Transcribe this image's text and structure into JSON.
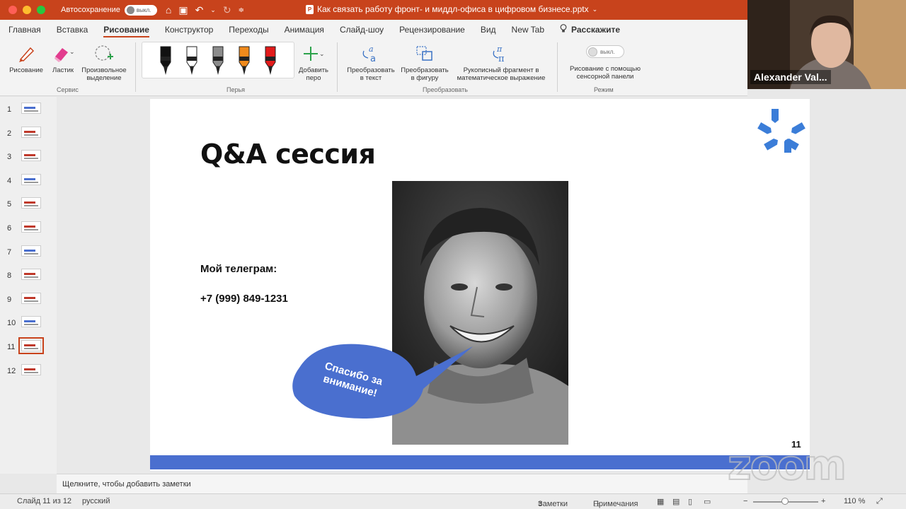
{
  "window": {
    "autosave_label": "Автосохранение",
    "autosave_state": "выкл.",
    "doc_title": "Как связать работу фронт- и миддл-офиса в цифровом бизнесе.pptx"
  },
  "tabs": [
    {
      "label": "Главная"
    },
    {
      "label": "Вставка"
    },
    {
      "label": "Рисование"
    },
    {
      "label": "Конструктор"
    },
    {
      "label": "Переходы"
    },
    {
      "label": "Анимация"
    },
    {
      "label": "Слайд-шоу"
    },
    {
      "label": "Рецензирование"
    },
    {
      "label": "Вид"
    },
    {
      "label": "New Tab"
    }
  ],
  "tell_me": "Расскажите",
  "ribbon": {
    "draw": "Рисование",
    "eraser": "Ластик",
    "lasso_1": "Произвольное",
    "lasso_2": "выделение",
    "group_tools": "Сервис",
    "add_pen_1": "Добавить",
    "add_pen_2": "перо",
    "group_pens": "Перья",
    "to_text_1": "Преобразовать",
    "to_text_2": "в текст",
    "to_shape_1": "Преобразовать",
    "to_shape_2": "в фигуру",
    "ink_math_1": "Рукописный фрагмент в",
    "ink_math_2": "математическое выражение",
    "group_convert": "Преобразовать",
    "touch_state": "выкл.",
    "touch_1": "Рисование с помощью",
    "touch_2": "сенсорной панели",
    "group_mode": "Режим"
  },
  "pen_colors": [
    "#111111",
    "#ffffff",
    "#8c8c8c",
    "#f08a1c",
    "#e21b1b"
  ],
  "thumbnails": [
    "1",
    "2",
    "3",
    "4",
    "5",
    "6",
    "7",
    "8",
    "9",
    "10",
    "11",
    "12"
  ],
  "selected_slide": "11",
  "slide": {
    "title": "Q&A сессия",
    "telegram_label": "Мой телеграм:",
    "phone": "+7 (999) 849-1231",
    "bubble_line1": "Спасибо за",
    "bubble_line2": "внимание!",
    "number": "11",
    "accent_color": "#4a6fcf"
  },
  "notes_placeholder": "Щелкните, чтобы добавить заметки",
  "status": {
    "slide_info": "Слайд 11 из 12",
    "language": "русский",
    "notes": "Заметки",
    "comments": "Примечания",
    "zoom": "110 %"
  },
  "webcam": {
    "name": "Alexander Val..."
  },
  "watermark": "zoom"
}
